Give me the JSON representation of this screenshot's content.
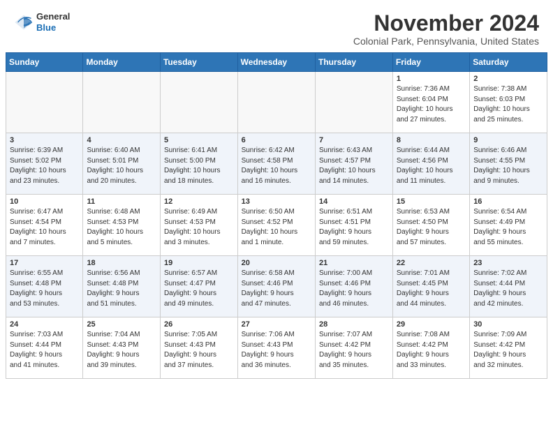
{
  "header": {
    "logo": {
      "general": "General",
      "blue": "Blue"
    },
    "month": "November 2024",
    "location": "Colonial Park, Pennsylvania, United States"
  },
  "weekdays": [
    "Sunday",
    "Monday",
    "Tuesday",
    "Wednesday",
    "Thursday",
    "Friday",
    "Saturday"
  ],
  "weeks": [
    [
      {
        "day": "",
        "info": ""
      },
      {
        "day": "",
        "info": ""
      },
      {
        "day": "",
        "info": ""
      },
      {
        "day": "",
        "info": ""
      },
      {
        "day": "",
        "info": ""
      },
      {
        "day": "1",
        "info": "Sunrise: 7:36 AM\nSunset: 6:04 PM\nDaylight: 10 hours\nand 27 minutes."
      },
      {
        "day": "2",
        "info": "Sunrise: 7:38 AM\nSunset: 6:03 PM\nDaylight: 10 hours\nand 25 minutes."
      }
    ],
    [
      {
        "day": "3",
        "info": "Sunrise: 6:39 AM\nSunset: 5:02 PM\nDaylight: 10 hours\nand 23 minutes."
      },
      {
        "day": "4",
        "info": "Sunrise: 6:40 AM\nSunset: 5:01 PM\nDaylight: 10 hours\nand 20 minutes."
      },
      {
        "day": "5",
        "info": "Sunrise: 6:41 AM\nSunset: 5:00 PM\nDaylight: 10 hours\nand 18 minutes."
      },
      {
        "day": "6",
        "info": "Sunrise: 6:42 AM\nSunset: 4:58 PM\nDaylight: 10 hours\nand 16 minutes."
      },
      {
        "day": "7",
        "info": "Sunrise: 6:43 AM\nSunset: 4:57 PM\nDaylight: 10 hours\nand 14 minutes."
      },
      {
        "day": "8",
        "info": "Sunrise: 6:44 AM\nSunset: 4:56 PM\nDaylight: 10 hours\nand 11 minutes."
      },
      {
        "day": "9",
        "info": "Sunrise: 6:46 AM\nSunset: 4:55 PM\nDaylight: 10 hours\nand 9 minutes."
      }
    ],
    [
      {
        "day": "10",
        "info": "Sunrise: 6:47 AM\nSunset: 4:54 PM\nDaylight: 10 hours\nand 7 minutes."
      },
      {
        "day": "11",
        "info": "Sunrise: 6:48 AM\nSunset: 4:53 PM\nDaylight: 10 hours\nand 5 minutes."
      },
      {
        "day": "12",
        "info": "Sunrise: 6:49 AM\nSunset: 4:53 PM\nDaylight: 10 hours\nand 3 minutes."
      },
      {
        "day": "13",
        "info": "Sunrise: 6:50 AM\nSunset: 4:52 PM\nDaylight: 10 hours\nand 1 minute."
      },
      {
        "day": "14",
        "info": "Sunrise: 6:51 AM\nSunset: 4:51 PM\nDaylight: 9 hours\nand 59 minutes."
      },
      {
        "day": "15",
        "info": "Sunrise: 6:53 AM\nSunset: 4:50 PM\nDaylight: 9 hours\nand 57 minutes."
      },
      {
        "day": "16",
        "info": "Sunrise: 6:54 AM\nSunset: 4:49 PM\nDaylight: 9 hours\nand 55 minutes."
      }
    ],
    [
      {
        "day": "17",
        "info": "Sunrise: 6:55 AM\nSunset: 4:48 PM\nDaylight: 9 hours\nand 53 minutes."
      },
      {
        "day": "18",
        "info": "Sunrise: 6:56 AM\nSunset: 4:48 PM\nDaylight: 9 hours\nand 51 minutes."
      },
      {
        "day": "19",
        "info": "Sunrise: 6:57 AM\nSunset: 4:47 PM\nDaylight: 9 hours\nand 49 minutes."
      },
      {
        "day": "20",
        "info": "Sunrise: 6:58 AM\nSunset: 4:46 PM\nDaylight: 9 hours\nand 47 minutes."
      },
      {
        "day": "21",
        "info": "Sunrise: 7:00 AM\nSunset: 4:46 PM\nDaylight: 9 hours\nand 46 minutes."
      },
      {
        "day": "22",
        "info": "Sunrise: 7:01 AM\nSunset: 4:45 PM\nDaylight: 9 hours\nand 44 minutes."
      },
      {
        "day": "23",
        "info": "Sunrise: 7:02 AM\nSunset: 4:44 PM\nDaylight: 9 hours\nand 42 minutes."
      }
    ],
    [
      {
        "day": "24",
        "info": "Sunrise: 7:03 AM\nSunset: 4:44 PM\nDaylight: 9 hours\nand 41 minutes."
      },
      {
        "day": "25",
        "info": "Sunrise: 7:04 AM\nSunset: 4:43 PM\nDaylight: 9 hours\nand 39 minutes."
      },
      {
        "day": "26",
        "info": "Sunrise: 7:05 AM\nSunset: 4:43 PM\nDaylight: 9 hours\nand 37 minutes."
      },
      {
        "day": "27",
        "info": "Sunrise: 7:06 AM\nSunset: 4:43 PM\nDaylight: 9 hours\nand 36 minutes."
      },
      {
        "day": "28",
        "info": "Sunrise: 7:07 AM\nSunset: 4:42 PM\nDaylight: 9 hours\nand 35 minutes."
      },
      {
        "day": "29",
        "info": "Sunrise: 7:08 AM\nSunset: 4:42 PM\nDaylight: 9 hours\nand 33 minutes."
      },
      {
        "day": "30",
        "info": "Sunrise: 7:09 AM\nSunset: 4:42 PM\nDaylight: 9 hours\nand 32 minutes."
      }
    ]
  ]
}
